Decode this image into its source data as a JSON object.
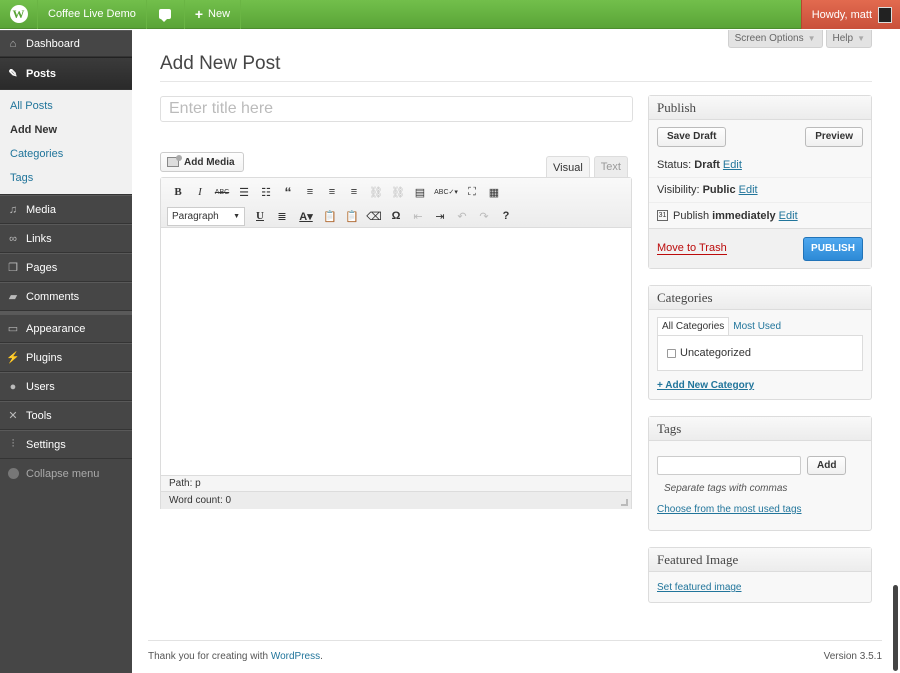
{
  "adminbar": {
    "wp_logo": "W",
    "site_name": "Coffee Live Demo",
    "new_label": "New",
    "howdy": "Howdy, matt"
  },
  "sidebar": {
    "dashboard": "Dashboard",
    "posts": "Posts",
    "submenu": [
      "All Posts",
      "Add New",
      "Categories",
      "Tags"
    ],
    "items": [
      "Media",
      "Links",
      "Pages",
      "Comments"
    ],
    "items2": [
      "Appearance",
      "Plugins",
      "Users",
      "Tools",
      "Settings"
    ],
    "collapse": "Collapse menu"
  },
  "screen_options": "Screen Options",
  "help": "Help",
  "page_title": "Add New Post",
  "title_placeholder": "Enter title here",
  "add_media": "Add Media",
  "editor_tabs": {
    "visual": "Visual",
    "text": "Text"
  },
  "toolbar": {
    "format_select": "Paragraph"
  },
  "editor": {
    "path": "Path: p",
    "word_count": "Word count: 0"
  },
  "publish_box": {
    "title": "Publish",
    "save_draft": "Save Draft",
    "preview": "Preview",
    "status_label": "Status:",
    "status_value": "Draft",
    "visibility_label": "Visibility:",
    "visibility_value": "Public",
    "publish_label": "Publish",
    "publish_value": "immediately",
    "edit": "Edit",
    "trash": "Move to Trash",
    "publish_button": "PUBLISH"
  },
  "categories_box": {
    "title": "Categories",
    "tab_all": "All Categories",
    "tab_most": "Most Used",
    "item": "Uncategorized",
    "add_new": "+ Add New Category"
  },
  "tags_box": {
    "title": "Tags",
    "add": "Add",
    "hint": "Separate tags with commas",
    "choose": "Choose from the most used tags"
  },
  "featured_box": {
    "title": "Featured Image",
    "set": "Set featured image"
  },
  "footer": {
    "text": "Thank you for creating with ",
    "link": "WordPress",
    "period": ".",
    "version": "Version 3.5.1"
  }
}
